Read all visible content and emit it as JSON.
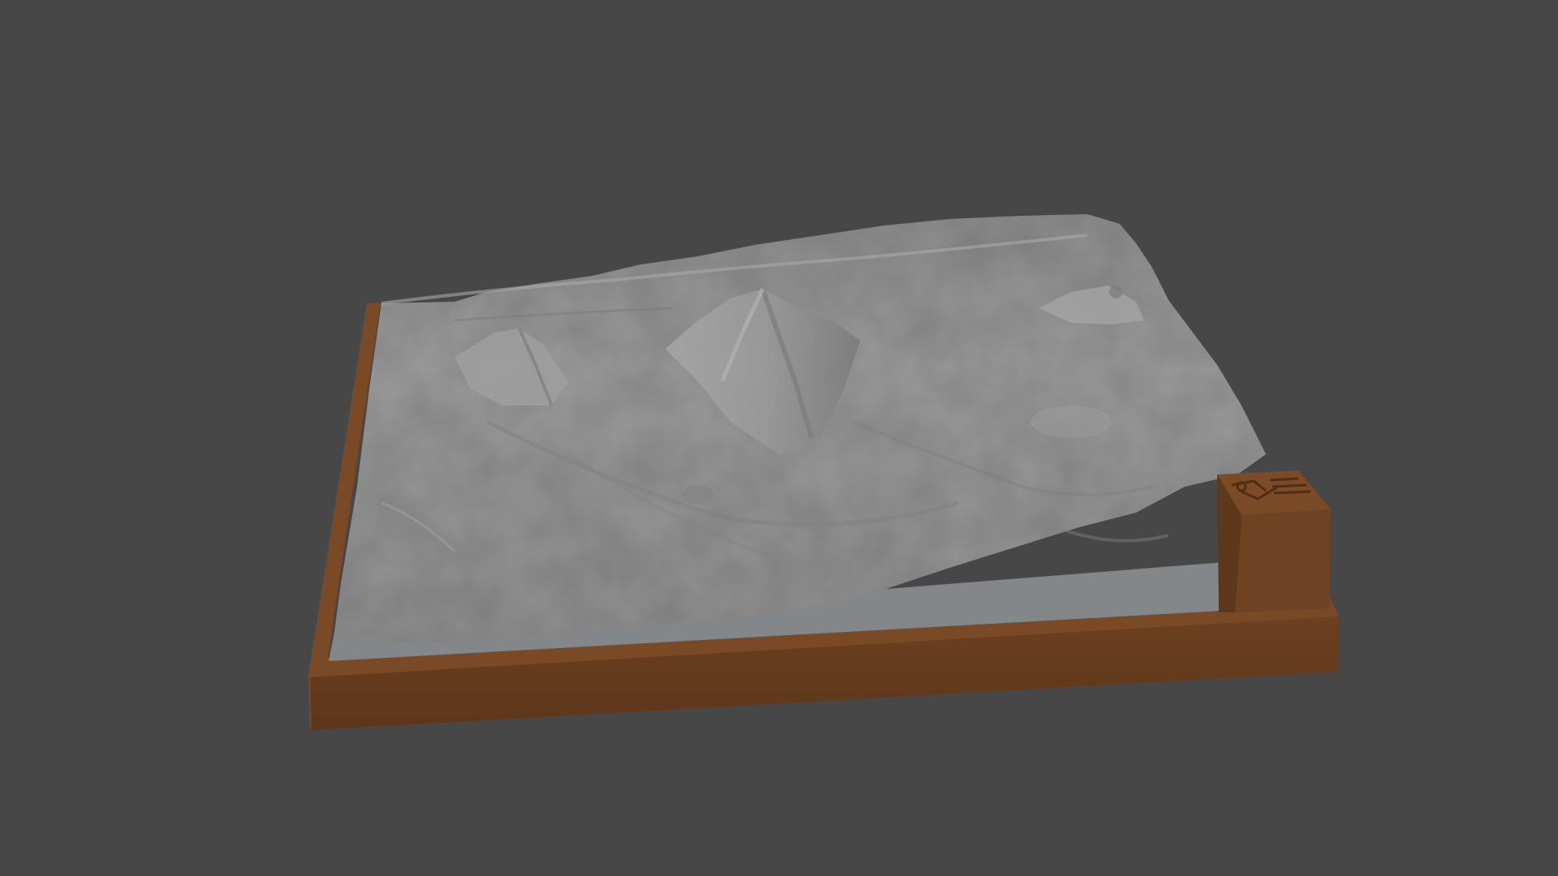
{
  "viewport": {
    "background_color": "#474747"
  },
  "model": {
    "kind": "3D terrain relief model on a base with a marker block",
    "terrain_color": "#9a9a9a",
    "terrain_shadow_color": "#6f6f6f",
    "terrain_highlight_color": "#b4b4b4",
    "base_color": "#6a3f1f",
    "base_side_color": "#5a3418",
    "base_top_color": "#7a4a26",
    "plate_color": "#8c8e8f",
    "marker_block_color": "#6e4222",
    "marker_engraving": "sun-and-mountain-logo-icon",
    "peak_count": 4
  }
}
